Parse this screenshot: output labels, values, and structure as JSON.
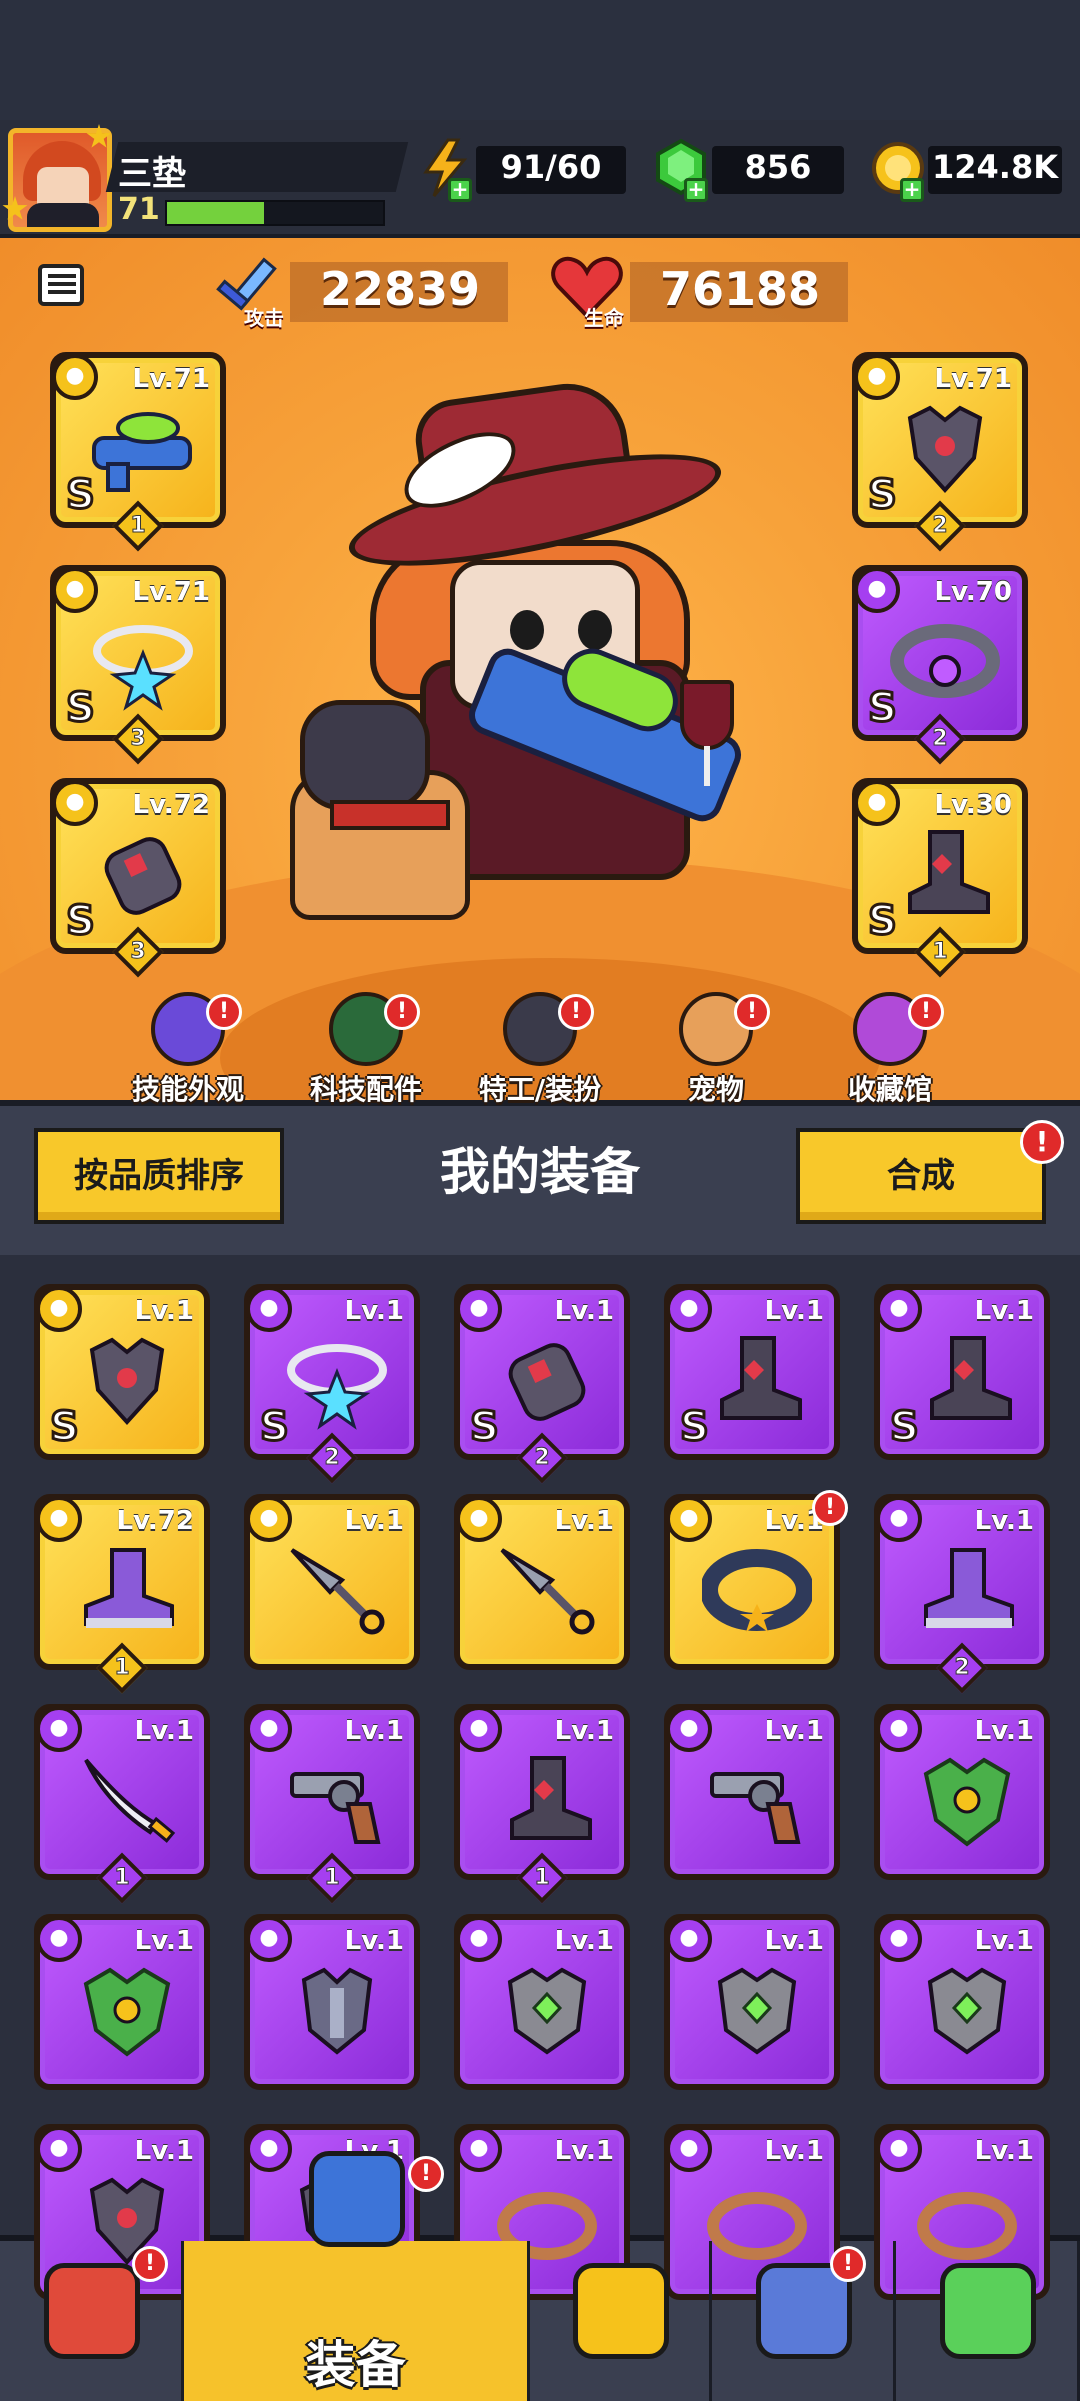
{
  "player": {
    "name": "三垫",
    "level": "71",
    "xp_fraction": 0.45
  },
  "resources": [
    {
      "name": "energy",
      "value": "91/60",
      "icon": "lightning-icon"
    },
    {
      "name": "gems",
      "value": "856",
      "icon": "green-gem-icon"
    },
    {
      "name": "coins",
      "value": "124.8K",
      "icon": "gold-coin-icon"
    }
  ],
  "stats": {
    "attack": {
      "label": "攻击",
      "value": "22839"
    },
    "hp": {
      "label": "生命",
      "value": "76188"
    }
  },
  "equipped_left": [
    {
      "slot": "weapon",
      "level": "Lv.71",
      "grade": "S",
      "stars": "1",
      "rarity": "gold",
      "icon": "water-gun-icon"
    },
    {
      "slot": "necklace",
      "level": "Lv.71",
      "grade": "S",
      "stars": "3",
      "rarity": "gold",
      "icon": "star-necklace-icon"
    },
    {
      "slot": "gloves",
      "level": "Lv.72",
      "grade": "S",
      "stars": "3",
      "rarity": "gold",
      "icon": "gauntlet-icon"
    }
  ],
  "equipped_right": [
    {
      "slot": "armor",
      "level": "Lv.71",
      "grade": "S",
      "stars": "2",
      "rarity": "gold",
      "icon": "armor-icon"
    },
    {
      "slot": "belt",
      "level": "Lv.70",
      "grade": "S",
      "stars": "2",
      "rarity": "purple",
      "icon": "belt-icon"
    },
    {
      "slot": "boots",
      "level": "Lv.30",
      "grade": "S",
      "stars": "1",
      "rarity": "gold",
      "icon": "boot-icon"
    }
  ],
  "categories": [
    {
      "label": "技能外观",
      "icon": "skill-skin-icon"
    },
    {
      "label": "科技配件",
      "icon": "tech-part-icon"
    },
    {
      "label": "特工/装扮",
      "icon": "agent-icon"
    },
    {
      "label": "宠物",
      "icon": "pet-icon"
    },
    {
      "label": "收藏馆",
      "icon": "collection-icon"
    }
  ],
  "inventory_header": {
    "sort_button": "按品质排序",
    "title": "我的装备",
    "merge_button": "合成"
  },
  "inventory": [
    {
      "level": "Lv.1",
      "grade": "S",
      "stars": "",
      "rarity": "gold",
      "icon": "armor-icon"
    },
    {
      "level": "Lv.1",
      "grade": "S",
      "stars": "2",
      "rarity": "purple",
      "icon": "star-necklace-icon"
    },
    {
      "level": "Lv.1",
      "grade": "S",
      "stars": "2",
      "rarity": "purple",
      "icon": "gauntlet-icon"
    },
    {
      "level": "Lv.1",
      "grade": "S",
      "stars": "",
      "rarity": "purple",
      "icon": "boot-icon"
    },
    {
      "level": "Lv.1",
      "grade": "S",
      "stars": "",
      "rarity": "purple",
      "icon": "boot-icon"
    },
    {
      "level": "Lv.72",
      "grade": "",
      "stars": "1",
      "rarity": "gold",
      "icon": "sneaker-icon"
    },
    {
      "level": "Lv.1",
      "grade": "",
      "stars": "",
      "rarity": "gold",
      "icon": "kunai-icon"
    },
    {
      "level": "Lv.1",
      "grade": "",
      "stars": "",
      "rarity": "gold",
      "icon": "kunai-icon"
    },
    {
      "level": "Lv.1",
      "grade": "",
      "stars": "",
      "rarity": "gold",
      "icon": "collar-icon"
    },
    {
      "level": "Lv.1",
      "grade": "",
      "stars": "2",
      "rarity": "purple",
      "icon": "sneaker-icon"
    },
    {
      "level": "Lv.1",
      "grade": "",
      "stars": "1",
      "rarity": "purple",
      "icon": "sword-icon"
    },
    {
      "level": "Lv.1",
      "grade": "",
      "stars": "1",
      "rarity": "purple",
      "icon": "revolver-icon"
    },
    {
      "level": "Lv.1",
      "grade": "",
      "stars": "1",
      "rarity": "purple",
      "icon": "boot-icon"
    },
    {
      "level": "Lv.1",
      "grade": "",
      "stars": "",
      "rarity": "purple",
      "icon": "revolver-icon"
    },
    {
      "level": "Lv.1",
      "grade": "",
      "stars": "",
      "rarity": "purple",
      "icon": "green-armor-icon"
    },
    {
      "level": "Lv.1",
      "grade": "",
      "stars": "",
      "rarity": "purple",
      "icon": "green-armor-icon"
    },
    {
      "level": "Lv.1",
      "grade": "",
      "stars": "",
      "rarity": "purple",
      "icon": "knight-armor-icon"
    },
    {
      "level": "Lv.1",
      "grade": "",
      "stars": "",
      "rarity": "purple",
      "icon": "gem-armor-icon"
    },
    {
      "level": "Lv.1",
      "grade": "",
      "stars": "",
      "rarity": "purple",
      "icon": "gem-armor-icon"
    },
    {
      "level": "Lv.1",
      "grade": "",
      "stars": "",
      "rarity": "purple",
      "icon": "gem-armor-icon"
    },
    {
      "level": "Lv.1",
      "grade": "",
      "stars": "",
      "rarity": "purple",
      "icon": "armor-icon"
    },
    {
      "level": "Lv.1",
      "grade": "",
      "stars": "",
      "rarity": "purple",
      "icon": "armor-icon"
    },
    {
      "level": "Lv.1",
      "grade": "",
      "stars": "",
      "rarity": "purple",
      "icon": "ring-icon"
    },
    {
      "level": "Lv.1",
      "grade": "",
      "stars": "",
      "rarity": "purple",
      "icon": "ring-icon"
    },
    {
      "level": "Lv.1",
      "grade": "",
      "stars": "",
      "rarity": "purple",
      "icon": "ring-icon"
    }
  ],
  "bottom_nav": [
    {
      "label": "",
      "icon": "shop-icon",
      "active": false
    },
    {
      "label": "装备",
      "icon": "equipment-icon",
      "active": true
    },
    {
      "label": "",
      "icon": "battle-star-icon",
      "active": false
    },
    {
      "label": "",
      "icon": "planet-icon",
      "active": false
    },
    {
      "label": "",
      "icon": "gene-capsule-icon",
      "active": false
    }
  ],
  "colors": {
    "gold": "#f6b21a",
    "purple": "#9a3ae6",
    "accent": "#f8c82a",
    "alert": "#e02a2a"
  }
}
